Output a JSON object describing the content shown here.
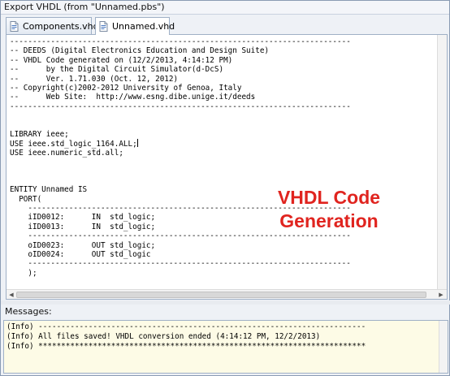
{
  "window": {
    "title": "Export VHDL (from \"Unnamed.pbs\")"
  },
  "tabs": [
    {
      "label": "Components.vhd",
      "active": false
    },
    {
      "label": "Unnamed.vhd",
      "active": true
    }
  ],
  "editor": {
    "lines": [
      "---------------------------------------------------------------------------",
      "-- DEEDS (Digital Electronics Education and Design Suite)",
      "-- VHDL Code generated on (12/2/2013, 4:14:12 PM)",
      "--      by the Digital Circuit Simulator(d-DcS)",
      "--      Ver. 1.71.030 (Oct. 12, 2012)",
      "-- Copyright(c)2002-2012 University of Genoa, Italy",
      "--      Web Site:  http://www.esng.dibe.unige.it/deeds",
      "---------------------------------------------------------------------------",
      "",
      "",
      "LIBRARY ieee;",
      "USE ieee.std_logic_1164.ALL;",
      "USE ieee.numeric_std.all;",
      "",
      "",
      "",
      "ENTITY Unnamed IS",
      "  PORT(",
      "    -----------------------------------------------------------------------",
      "    iID0012:      IN  std_logic;",
      "    iID0013:      IN  std_logic;",
      "    -----------------------------------------------------------------------",
      "    oID0023:      OUT std_logic;",
      "    oID0024:      OUT std_logic",
      "    -----------------------------------------------------------------------",
      "    );"
    ],
    "caret_line": 11
  },
  "overlay": {
    "line1": "VHDL Code",
    "line2": "Generation",
    "color": "#e0241f"
  },
  "messages": {
    "label": "Messages:",
    "lines": [
      "(Info) ------------------------------------------------------------------------",
      "(Info) All files saved! VHDL conversion ended (4:14:12 PM, 12/2/2013)",
      "(Info) ************************************************************************"
    ]
  },
  "icons": {
    "tab_icon": "vhd-document-icon"
  }
}
